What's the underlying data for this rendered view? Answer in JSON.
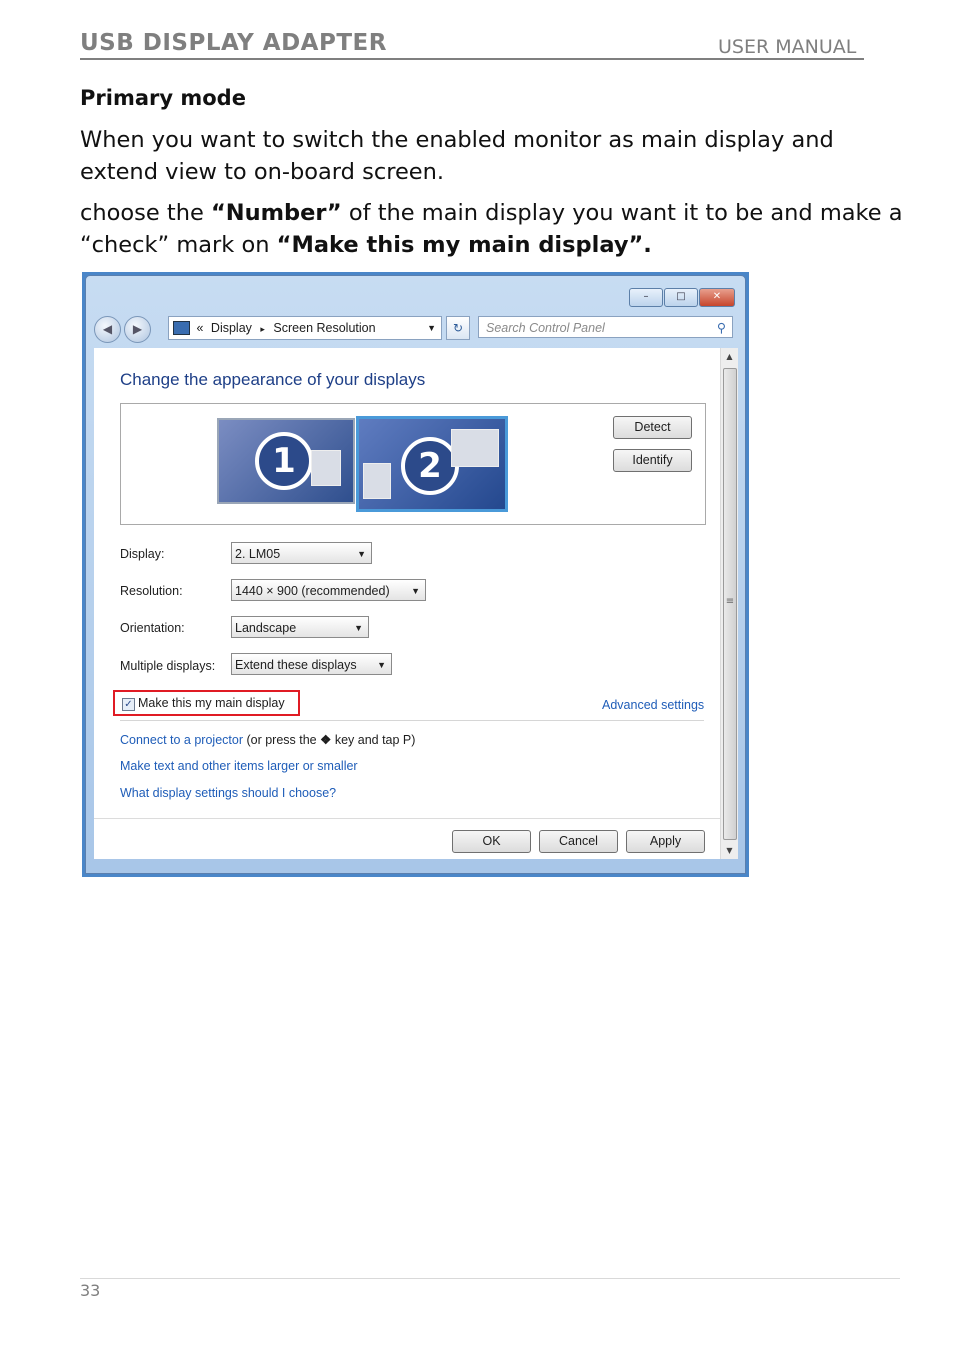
{
  "header": {
    "left": "USB DISPLAY ADAPTER",
    "right": "USER MANUAL"
  },
  "section_title": "Primary mode",
  "para1": "When you want to switch the enabled monitor as main display and extend view to on-board screen.",
  "para2": {
    "t1": "choose the ",
    "b1": "“Number”",
    "t2": " of the main display you want it to be and make a “check” mark on ",
    "b2": "“Make this my main display”."
  },
  "window": {
    "caption_buttons": [
      "–",
      "□",
      "✕"
    ],
    "breadcrumb": {
      "chev": "«",
      "part1": "Display",
      "sep": "▸",
      "part2": "Screen Resolution"
    },
    "search_placeholder": "Search Control Panel",
    "heading": "Change the appearance of your displays",
    "monitors": [
      "1",
      "2"
    ],
    "buttons": {
      "detect": "Detect",
      "identify": "Identify"
    },
    "fields": {
      "display_label": "Display:",
      "display_value": "2. LM05",
      "resolution_label": "Resolution:",
      "resolution_value": "1440 × 900 (recommended)",
      "orientation_label": "Orientation:",
      "orientation_value": "Landscape",
      "multiple_label": "Multiple displays:",
      "multiple_value": "Extend these displays"
    },
    "checkbox_label": "Make this my main display",
    "advanced": "Advanced settings",
    "link_projector": "Connect to a projector",
    "projector_rest1": " (or press the ",
    "projector_rest2": " key and tap P)",
    "link_text_size": "Make text and other items larger or smaller",
    "link_help": "What display settings should I choose?",
    "ok": "OK",
    "cancel": "Cancel",
    "apply": "Apply"
  },
  "page_number": "33"
}
